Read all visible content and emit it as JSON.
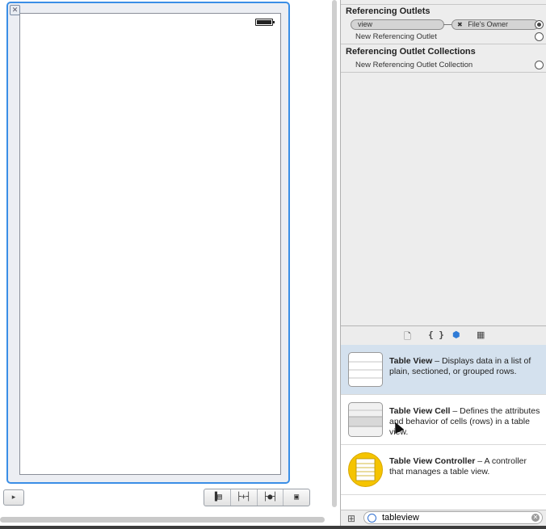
{
  "canvas": {
    "close_glyph": "✕",
    "doc_outline_glyph": "▸",
    "layout_buttons": [
      "▐▤",
      "├+┤",
      "├●┤",
      "▣"
    ]
  },
  "connections": {
    "referencing_outlets_title": "Referencing Outlets",
    "outlet_source": "view",
    "outlet_remove_glyph": "✖",
    "outlet_target": "File's Owner",
    "new_referencing_outlet": "New Referencing Outlet",
    "collections_title": "Referencing Outlet Collections",
    "new_referencing_outlet_collection": "New Referencing Outlet Collection"
  },
  "library_tabs": {
    "file_template": "🗋",
    "code_snippet": "{ }",
    "object": "⬢",
    "media": "▦"
  },
  "library": {
    "items": [
      {
        "title": "Table View",
        "desc": " – Displays data in a list of plain, sectioned, or grouped rows.",
        "selected": true
      },
      {
        "title": "Table View Cell",
        "desc": " – Defines the attributes and behavior of cells (rows) in a table view.",
        "selected": false
      },
      {
        "title": "Table View Controller",
        "desc": " – A controller that manages a table view.",
        "selected": false
      }
    ]
  },
  "filter": {
    "grid_glyph": "⊞",
    "value": "tableview",
    "clear_glyph": "✕"
  },
  "colors": {
    "selection_blue": "#3a8ee6",
    "selected_row": "#d4e1ee",
    "controller_yellow": "#f5c400"
  }
}
